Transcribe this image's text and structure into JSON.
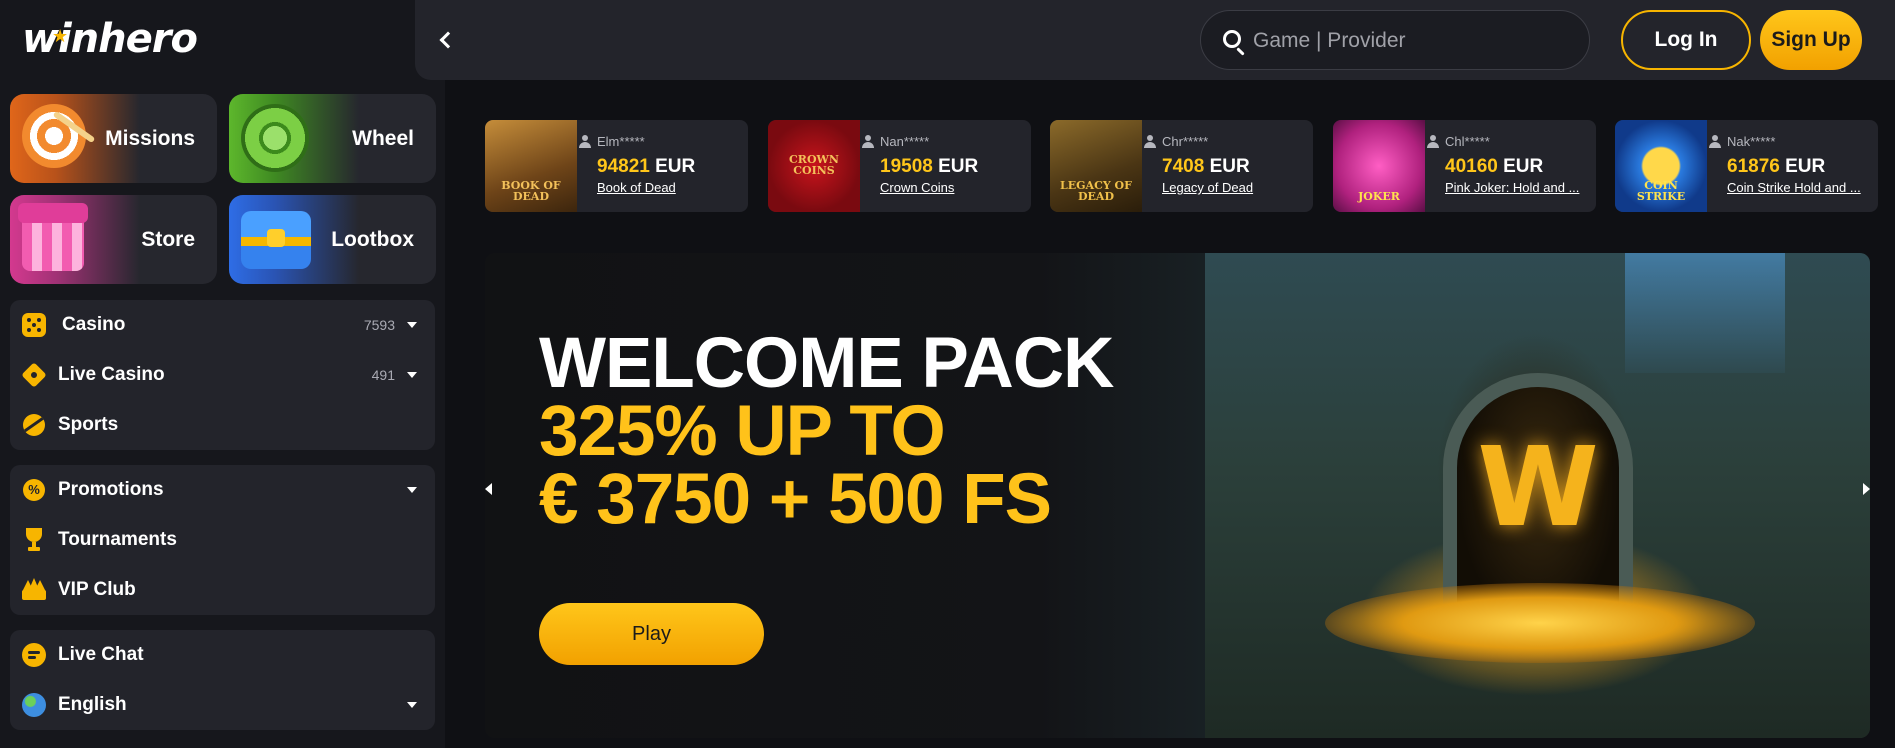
{
  "brand": {
    "logo_text": "winhero",
    "accent": "#f7b500"
  },
  "tiles": [
    {
      "label": "Missions"
    },
    {
      "label": "Wheel"
    },
    {
      "label": "Store"
    },
    {
      "label": "Lootbox"
    }
  ],
  "menu": {
    "games": [
      {
        "label": "Casino",
        "count": "7593",
        "icon": "dice-icon"
      },
      {
        "label": "Live Casino",
        "count": "491",
        "icon": "diamond-icon"
      },
      {
        "label": "Sports",
        "icon": "ball-icon"
      }
    ],
    "extras": [
      {
        "label": "Promotions",
        "icon": "promo-icon"
      },
      {
        "label": "Tournaments",
        "icon": "trophy-icon"
      },
      {
        "label": "VIP Club",
        "icon": "crown-icon"
      }
    ],
    "support": [
      {
        "label": "Live Chat",
        "icon": "chat-icon"
      },
      {
        "label": "English",
        "icon": "globe-icon"
      }
    ]
  },
  "header": {
    "search_placeholder": "Game | Provider",
    "login_label": "Log In",
    "signup_label": "Sign Up"
  },
  "winners": [
    {
      "user": "Elm*****",
      "amount": "94821",
      "currency": "EUR",
      "game": "Book of Dead",
      "thumb_text": "BOOK OF DEAD"
    },
    {
      "user": "Nan*****",
      "amount": "19508",
      "currency": "EUR",
      "game": "Crown Coins",
      "thumb_text": "CROWN COINS"
    },
    {
      "user": "Chr*****",
      "amount": "7408",
      "currency": "EUR",
      "game": "Legacy of Dead",
      "thumb_text": "LEGACY OF DEAD"
    },
    {
      "user": "Chl*****",
      "amount": "40160",
      "currency": "EUR",
      "game": "Pink Joker: Hold and ...",
      "thumb_text": "JOKER"
    },
    {
      "user": "Nak*****",
      "amount": "61876",
      "currency": "EUR",
      "game": "Coin Strike Hold and ...",
      "thumb_text": "COIN STRIKE"
    }
  ],
  "hero": {
    "line1": "WELCOME PACK",
    "line2": "325% UP TO",
    "line3": "€ 3750 + 500 FS",
    "play_label": "Play",
    "emblem": "W"
  }
}
